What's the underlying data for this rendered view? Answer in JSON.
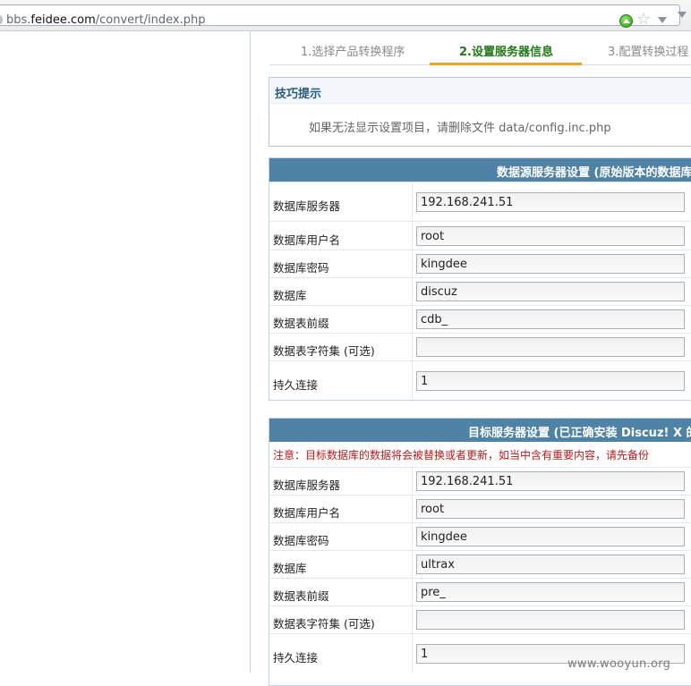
{
  "browser": {
    "url_prefix": "bbs.",
    "url_domain": "feidee.com",
    "url_path": "/convert/index.php"
  },
  "steps": [
    {
      "label": "1.选择产品转换程序"
    },
    {
      "label": "2.设置服务器信息"
    },
    {
      "label": "3.配置转换过程"
    }
  ],
  "tips": {
    "title": "技巧提示",
    "text": "如果无法显示设置项目，请删除文件 data/config.inc.php"
  },
  "source_panel": {
    "title": "数据源服务器设置 (原始版本的数据库",
    "rows": [
      {
        "label": "数据库服务器",
        "value": "192.168.241.51"
      },
      {
        "label": "数据库用户名",
        "value": "root"
      },
      {
        "label": "数据库密码",
        "value": "kingdee"
      },
      {
        "label": "数据库",
        "value": "discuz"
      },
      {
        "label": "数据表前缀",
        "value": "cdb_"
      },
      {
        "label": "数据表字符集 (可选)",
        "value": ""
      },
      {
        "label": "持久连接",
        "value": "1"
      }
    ]
  },
  "target_panel": {
    "title": "目标服务器设置 (已正确安装 Discuz! X 的数",
    "warning": "注意：目标数据库的数据将会被替换或者更新，如当中含有重要内容，请先备份",
    "rows": [
      {
        "label": "数据库服务器",
        "value": "192.168.241.51"
      },
      {
        "label": "数据库用户名",
        "value": "root"
      },
      {
        "label": "数据库密码",
        "value": "kingdee"
      },
      {
        "label": "数据库",
        "value": "ultrax"
      },
      {
        "label": "数据表前缀",
        "value": "pre_"
      },
      {
        "label": "数据表字符集 (可选)",
        "value": ""
      },
      {
        "label": "持久连接",
        "value": "1"
      }
    ]
  },
  "watermark": "www.wooyun.org"
}
